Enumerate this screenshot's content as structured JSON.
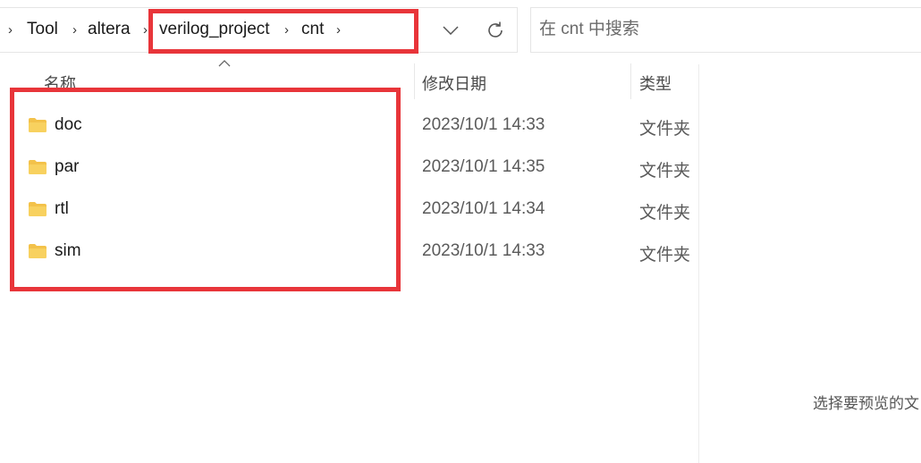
{
  "address_bar": {
    "breadcrumbs": [
      "Tool",
      "altera",
      "verilog_project",
      "cnt"
    ],
    "separator_icon": "chevron-right-icon",
    "history_dropdown_icon": "chevron-down-icon",
    "refresh_icon": "refresh-icon"
  },
  "search": {
    "placeholder": "在 cnt 中搜索",
    "value": ""
  },
  "columns": {
    "name": "名称",
    "date_modified": "修改日期",
    "type": "类型",
    "sort_indicator": "sort-ascending-icon"
  },
  "files": [
    {
      "name": "doc",
      "modified": "2023/10/1 14:33",
      "type": "文件夹",
      "icon": "folder-icon"
    },
    {
      "name": "par",
      "modified": "2023/10/1 14:35",
      "type": "文件夹",
      "icon": "folder-icon"
    },
    {
      "name": "rtl",
      "modified": "2023/10/1 14:34",
      "type": "文件夹",
      "icon": "folder-icon"
    },
    {
      "name": "sim",
      "modified": "2023/10/1 14:33",
      "type": "文件夹",
      "icon": "folder-icon"
    }
  ],
  "preview_pane": {
    "message": "选择要预览的文"
  },
  "colors": {
    "annotation": "#e8353a",
    "folder": "#f3c24a"
  }
}
